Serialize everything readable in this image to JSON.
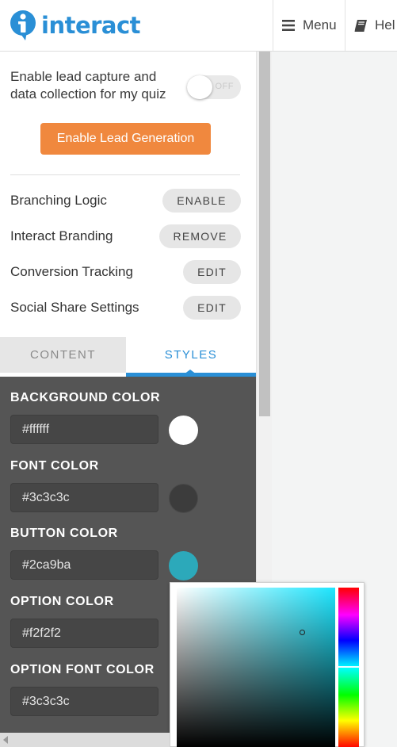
{
  "header": {
    "logo_text": "interact",
    "menu_label": "Menu",
    "help_label": "Hel"
  },
  "lead": {
    "description": "Enable lead capture and data collection for my quiz",
    "toggle_state": "OFF",
    "button_label": "Enable Lead Generation"
  },
  "settings": [
    {
      "label": "Branching Logic",
      "action": "ENABLE"
    },
    {
      "label": "Interact Branding",
      "action": "REMOVE"
    },
    {
      "label": "Conversion Tracking",
      "action": "EDIT"
    },
    {
      "label": "Social Share Settings",
      "action": "EDIT"
    }
  ],
  "tabs": {
    "content": "CONTENT",
    "styles": "STYLES",
    "active": "STYLES"
  },
  "styles": [
    {
      "label": "BACKGROUND COLOR",
      "value": "#ffffff",
      "swatch": "#ffffff"
    },
    {
      "label": "FONT COLOR",
      "value": "#3c3c3c",
      "swatch": "#3c3c3c"
    },
    {
      "label": "BUTTON COLOR",
      "value": "#2ca9ba",
      "swatch": "#2ca9ba"
    },
    {
      "label": "OPTION COLOR",
      "value": "#f2f2f2",
      "swatch": "#f2f2f2"
    },
    {
      "label": "OPTION FONT COLOR",
      "value": "#3c3c3c",
      "swatch": "#3c3c3c"
    }
  ],
  "colors": {
    "brand_blue": "#2a8fd6",
    "lead_button": "#f0883e",
    "styles_bg": "#555555",
    "picker_hue": "#1ee6ff"
  }
}
